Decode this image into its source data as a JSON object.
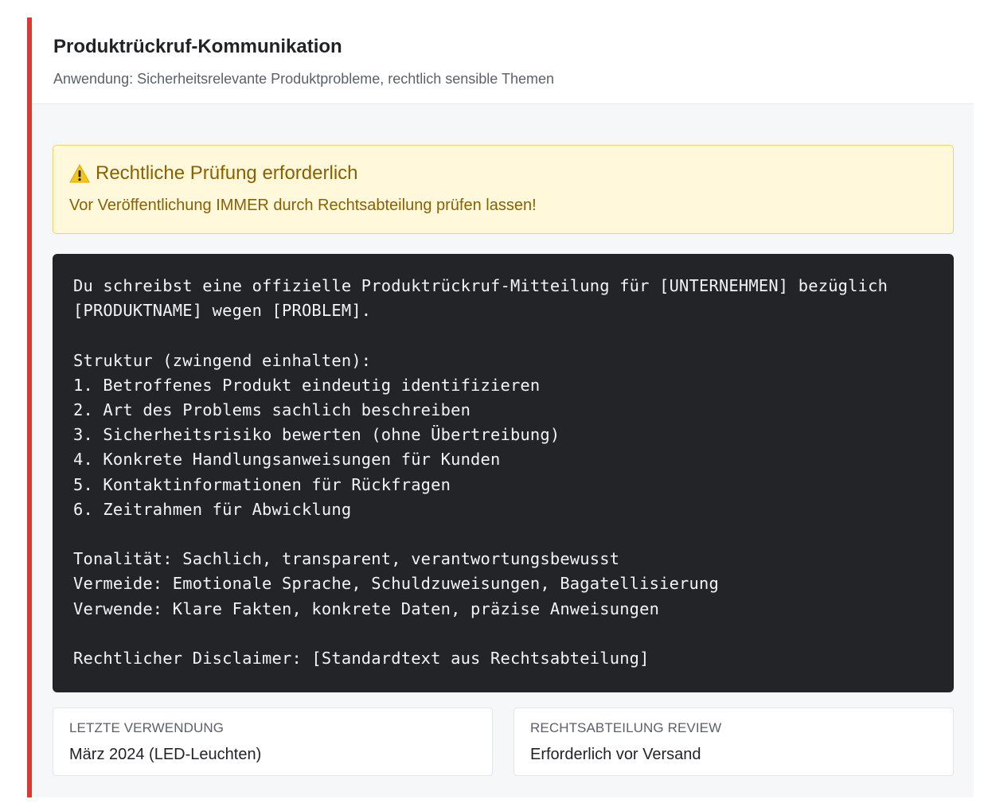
{
  "header": {
    "title": "Produktrückruf-Kommunikation",
    "subtitle": "Anwendung: Sicherheitsrelevante Produktprobleme, rechtlich sensible Themen"
  },
  "alert": {
    "icon": "warning-icon",
    "title": "Rechtliche Prüfung erforderlich",
    "text": "Vor Veröffentlichung IMMER durch Rechtsabteilung prüfen lassen!"
  },
  "prompt": {
    "lines": [
      "Du schreibst eine offizielle Produktrückruf-Mitteilung für [UNTERNEHMEN] bezüglich",
      "[PRODUKTNAME] wegen [PROBLEM].",
      "",
      "Struktur (zwingend einhalten):",
      "1. Betroffenes Produkt eindeutig identifizieren",
      "2. Art des Problems sachlich beschreiben",
      "3. Sicherheitsrisiko bewerten (ohne Übertreibung)",
      "4. Konkrete Handlungsanweisungen für Kunden",
      "5. Kontaktinformationen für Rückfragen",
      "6. Zeitrahmen für Abwicklung",
      "",
      "Tonalität: Sachlich, transparent, verantwortungsbewusst",
      "Vermeide: Emotionale Sprache, Schuldzuweisungen, Bagatellisierung",
      "Verwende: Klare Fakten, konkrete Daten, präzise Anweisungen",
      "",
      "Rechtlicher Disclaimer: [Standardtext aus Rechtsabteilung]"
    ]
  },
  "info": {
    "last_used_label": "Letzte Verwendung",
    "last_used_value": "März 2024 (LED-Leuchten)",
    "review_label": "Rechtsabteilung Review",
    "review_value": "Erforderlich vor Versand"
  },
  "colors": {
    "accent": "#d63c31",
    "alert_bg": "#fff8db",
    "alert_text": "#8a6100",
    "code_bg": "#232428"
  }
}
